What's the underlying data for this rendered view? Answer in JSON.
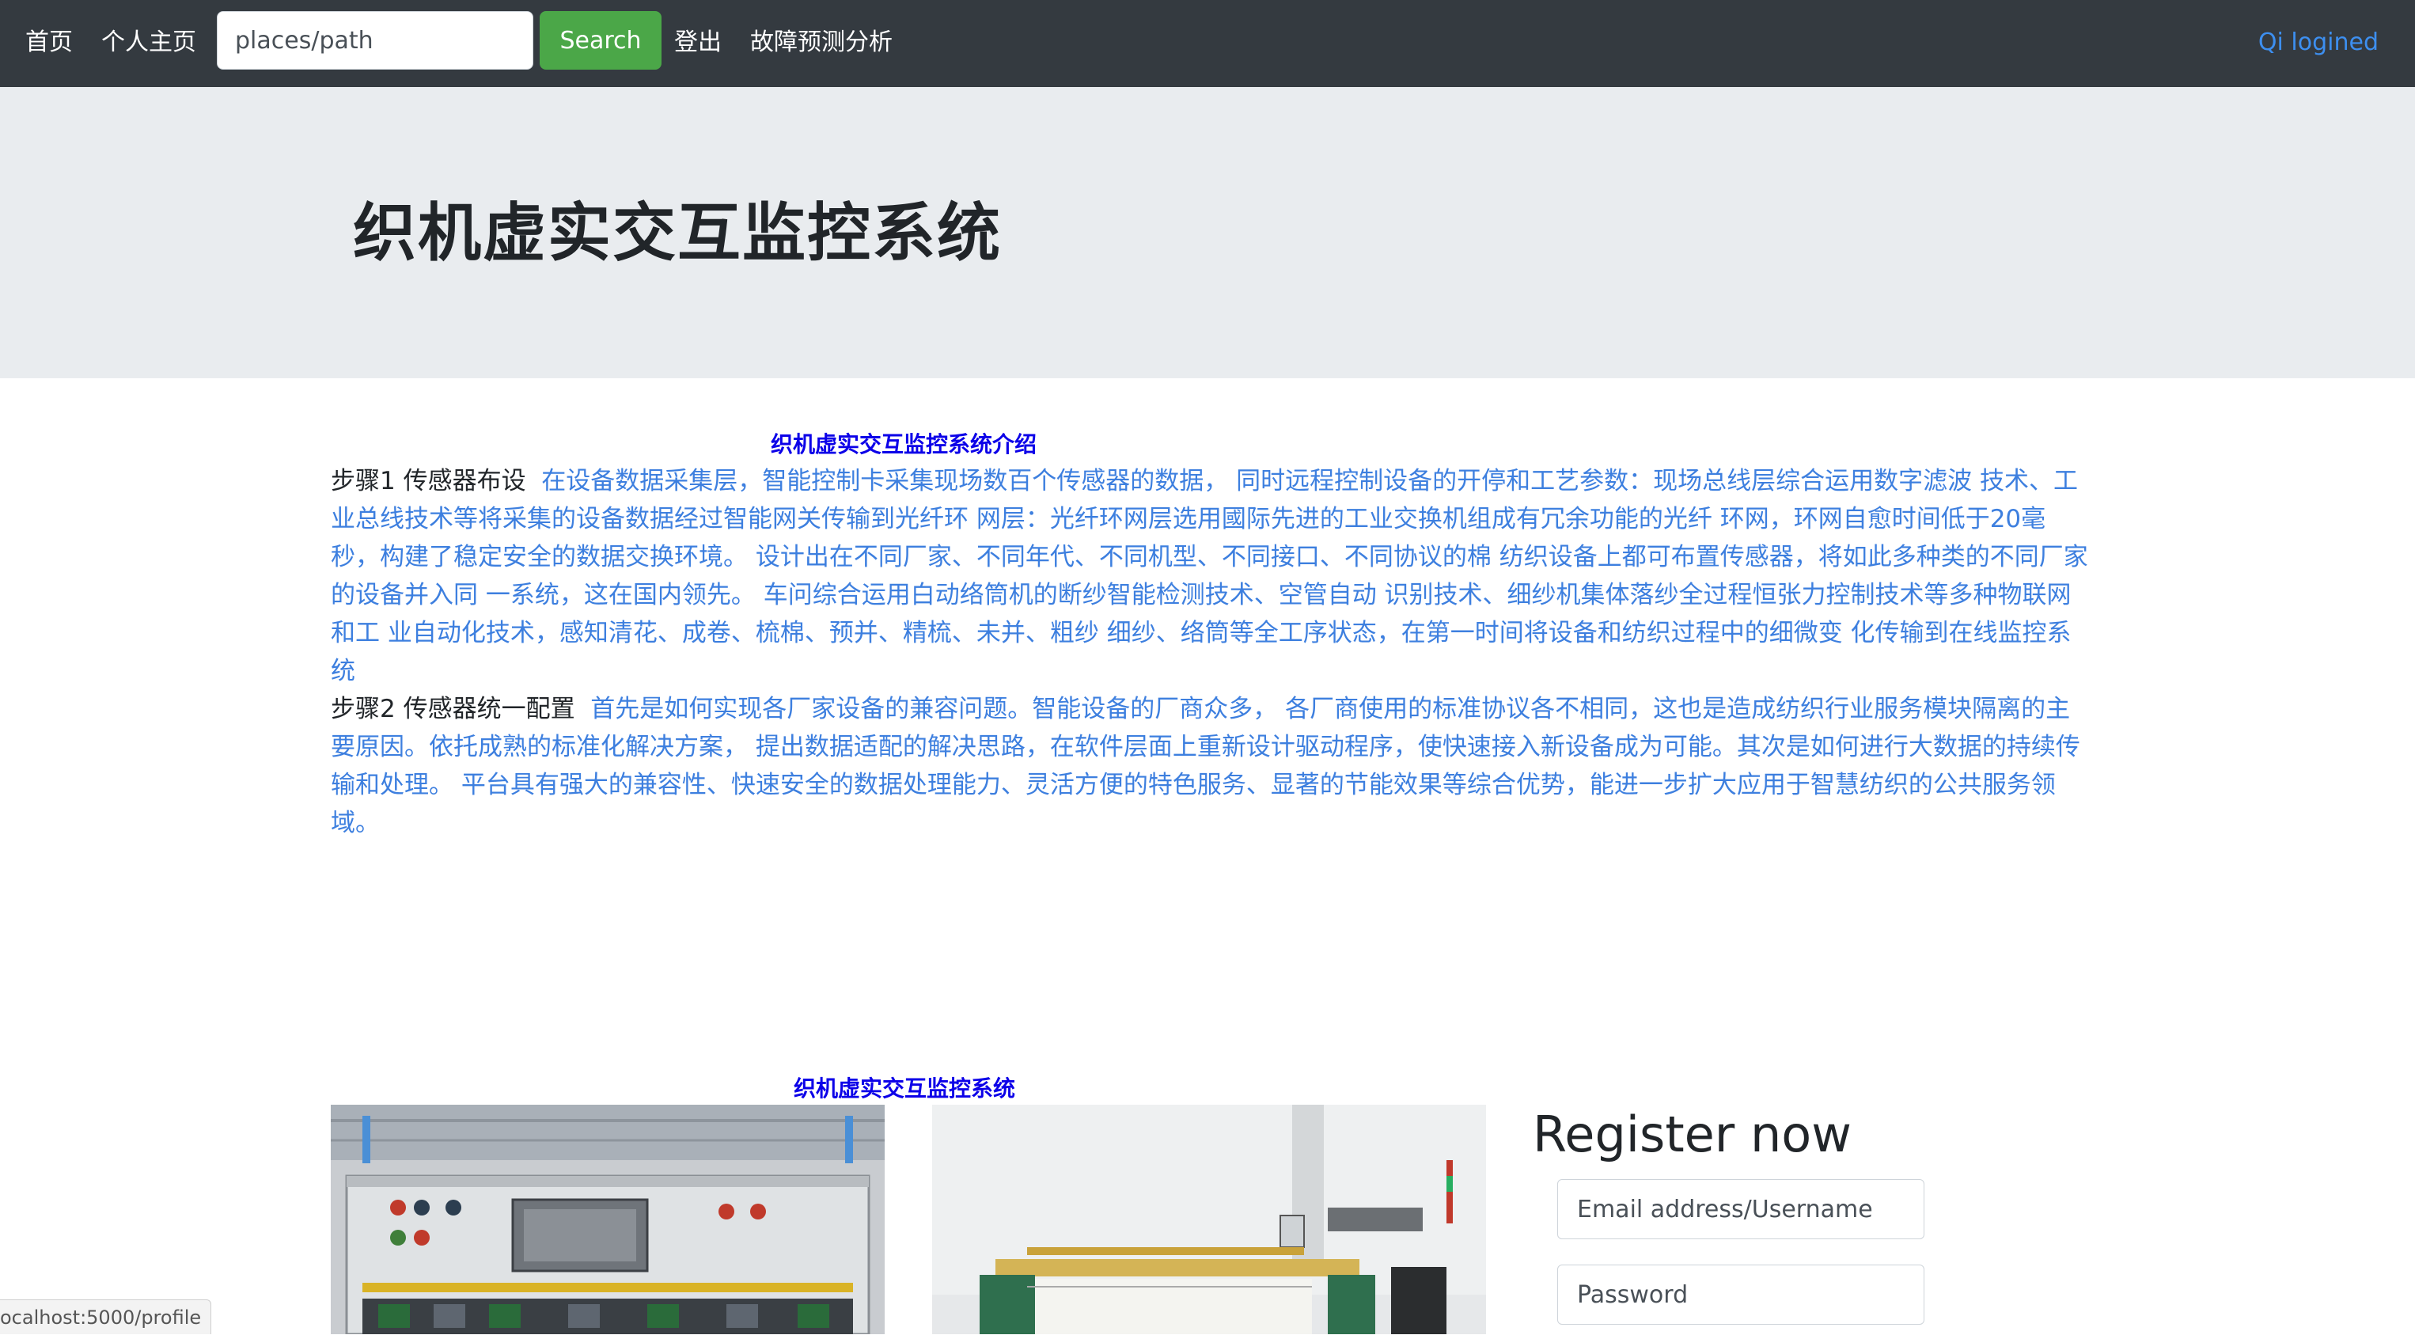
{
  "nav": {
    "home": "首页",
    "profile": "个人主页",
    "search_placeholder": "places/path",
    "search_button": "Search",
    "logout": "登出",
    "fault_analysis": "故障预测分析",
    "user_status": "Qi logined"
  },
  "hero": {
    "title": "织机虚实交互监控系统"
  },
  "intro": {
    "heading": "织机虚实交互监控系统介绍",
    "step1_label": "步骤1 传感器布设",
    "step1_text": "在设备数据采集层，智能控制卡采集现场数百个传感器的数据， 同时远程控制设备的开停和工艺参数：现场总线层综合运用数字滤波 技术、工业总线技术等将采集的设备数据经过智能网关传输到光纤环 网层：光纤环网层选用國际先进的工业交换机组成有冗余功能的光纤 环网，环网自愈时间低于20毫秒，构建了稳定安全的数据交换环境。 设计出在不同厂家、不同年代、不同机型、不同接口、不同协议的棉 纺织设备上都可布置传感器，将如此多种类的不同厂家的设备并入同 一系统，这在国内领先。 车问综合运用白动络筒机的断纱智能检测技术、空管自动 识别技术、细纱机集体落纱全过程恒张力控制技术等多种物联网和工 业自动化技术，感知清花、成卷、梳棉、预并、精梳、未并、粗纱 细纱、络筒等全工序状态，在第一时间将设备和纺织过程中的细微变 化传输到在线监控系统",
    "step2_label": "步骤2 传感器统一配置",
    "step2_text": "首先是如何实现各厂家设备的兼容问题。智能设备的厂商众多， 各厂商使用的标准协议各不相同，这也是造成纺织行业服务模块隔离的主要原因。依托成熟的标准化解决方案， 提出数据适配的解决思路，在软件层面上重新设计驱动程序，使快速接入新设备成为可能。其次是如何进行大数据的持续传输和处理。 平台具有强大的兼容性、快速安全的数据处理能力、灵活方便的特色服务、显著的节能效果等综合优势，能进一步扩大应用于智慧纺织的公共服务领域。"
  },
  "gallery": {
    "heading": "织机虚实交互监控系统"
  },
  "register": {
    "title": "Register now",
    "email_placeholder": "Email address/Username",
    "password_placeholder": "Password"
  },
  "status_bar": {
    "url": "ocalhost:5000/profile"
  },
  "colors": {
    "navbar_bg": "#343a40",
    "search_button_bg": "#4ba748",
    "link_blue": "#3d7fdf",
    "heading_blue": "#0c00e8",
    "hero_bg": "#e9ecef"
  }
}
